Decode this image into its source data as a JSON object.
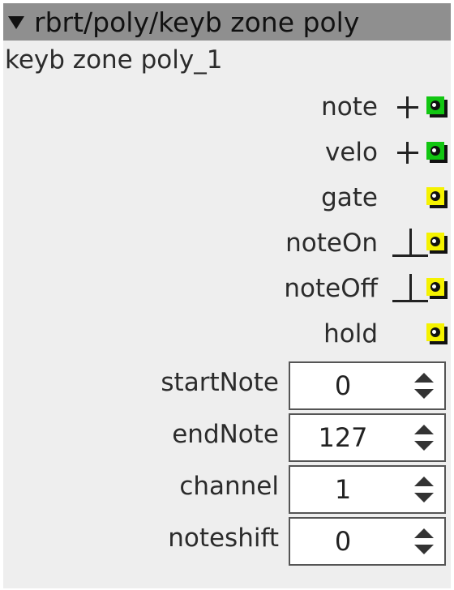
{
  "header": {
    "collapse_icon": "triangle-down-icon",
    "title": "rbrt/poly/keyb zone poly"
  },
  "module": {
    "instance_name": "keyb zone poly_1"
  },
  "outputs": [
    {
      "label": "note",
      "symbol": "plus",
      "color": "#11c611"
    },
    {
      "label": "velo",
      "symbol": "plus",
      "color": "#11c611"
    },
    {
      "label": "gate",
      "symbol": "none",
      "color": "#f5f200"
    },
    {
      "label": "noteOn",
      "symbol": "trigger",
      "color": "#f5f200"
    },
    {
      "label": "noteOff",
      "symbol": "trigger",
      "color": "#f5f200"
    },
    {
      "label": "hold",
      "symbol": "none",
      "color": "#f5f200"
    }
  ],
  "params": [
    {
      "label": "startNote",
      "value": "0"
    },
    {
      "label": "endNote",
      "value": "127"
    },
    {
      "label": "channel",
      "value": "1"
    },
    {
      "label": "noteshift",
      "value": "0"
    }
  ],
  "colors": {
    "titlebar": "#8f8f8f",
    "panel": "#eeeeee",
    "jack_frac": "#11c611",
    "jack_bool": "#f5f200"
  }
}
